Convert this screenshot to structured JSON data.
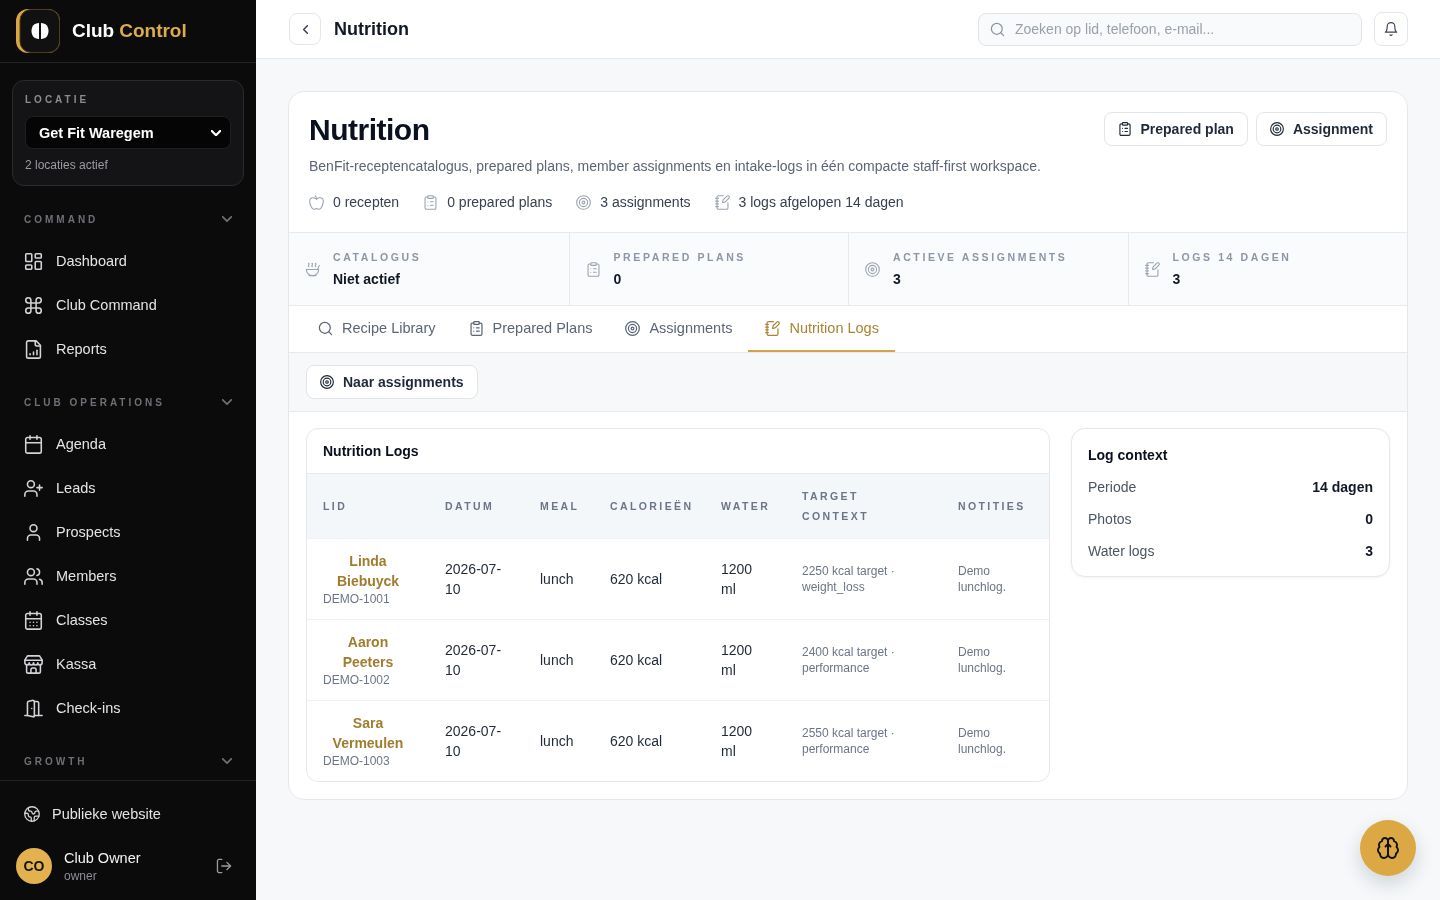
{
  "sidebar": {
    "brand": {
      "name": "Club",
      "accent": "Control"
    },
    "location": {
      "label": "LOCATIE",
      "value": "Get Fit Waregem",
      "note": "2 locaties actief"
    },
    "sections": [
      {
        "title": "COMMAND",
        "items": [
          {
            "label": "Dashboard",
            "selected": false
          },
          {
            "label": "Club Command",
            "selected": false
          },
          {
            "label": "Reports",
            "selected": false
          }
        ]
      },
      {
        "title": "CLUB OPERATIONS",
        "items": [
          {
            "label": "Agenda",
            "selected": false
          },
          {
            "label": "Leads",
            "selected": false
          },
          {
            "label": "Prospects",
            "selected": false
          },
          {
            "label": "Members",
            "selected": false
          },
          {
            "label": "Classes",
            "selected": false
          },
          {
            "label": "Kassa",
            "selected": false
          },
          {
            "label": "Check-ins",
            "selected": false
          }
        ]
      },
      {
        "title": "GROWTH"
      }
    ],
    "website_link": "Publieke website",
    "user": {
      "initials": "CO",
      "name": "Club Owner",
      "role": "owner"
    }
  },
  "topbar": {
    "title": "Nutrition",
    "search": {
      "placeholder": "Zoeken op lid, telefoon, e-mail..."
    }
  },
  "page": {
    "title": "Nutrition",
    "description": "BenFit-receptencatalogus, prepared plans, member assignments en intake-logs in één compacte staff-first workspace.",
    "actions": [
      "Prepared plan",
      "Assignment"
    ],
    "meta": [
      "0 recepten",
      "0 prepared plans",
      "3 assignments",
      "3 logs afgelopen 14 dagen"
    ],
    "stats": [
      {
        "label": "CATALOGUS",
        "value": "Niet actief"
      },
      {
        "label": "PREPARED PLANS",
        "value": "0"
      },
      {
        "label": "ACTIEVE ASSIGNMENTS",
        "value": "3"
      },
      {
        "label": "LOGS 14 DAGEN",
        "value": "3"
      }
    ],
    "tabs": [
      {
        "label": "Recipe Library",
        "selected": false
      },
      {
        "label": "Prepared Plans",
        "selected": false
      },
      {
        "label": "Assignments",
        "selected": false
      },
      {
        "label": "Nutrition Logs",
        "selected": true
      }
    ],
    "toolbar": {
      "button": "Naar assignments"
    },
    "logs_table": {
      "title": "Nutrition Logs",
      "columns": [
        "LID",
        "DATUM",
        "MEAL",
        "CALORIEËN",
        "WATER",
        "TARGET CONTEXT",
        "NOTITIES"
      ],
      "rows": [
        {
          "member": "Linda Biebuyck",
          "member_id": "DEMO-1001",
          "date": "2026-07-10",
          "meal": "lunch",
          "calories": "620 kcal",
          "water": "1200 ml",
          "target": "2250 kcal target · weight_loss",
          "notes": "Demo lunchlog."
        },
        {
          "member": "Aaron Peeters",
          "member_id": "DEMO-1002",
          "date": "2026-07-10",
          "meal": "lunch",
          "calories": "620 kcal",
          "water": "1200 ml",
          "target": "2400 kcal target · performance",
          "notes": "Demo lunchlog."
        },
        {
          "member": "Sara Vermeulen",
          "member_id": "DEMO-1003",
          "date": "2026-07-10",
          "meal": "lunch",
          "calories": "620 kcal",
          "water": "1200 ml",
          "target": "2550 kcal target · performance",
          "notes": "Demo lunchlog."
        }
      ]
    },
    "log_context": {
      "title": "Log context",
      "rows": [
        {
          "label": "Periode",
          "value": "14 dagen"
        },
        {
          "label": "Photos",
          "value": "0"
        },
        {
          "label": "Water logs",
          "value": "3"
        }
      ]
    }
  }
}
